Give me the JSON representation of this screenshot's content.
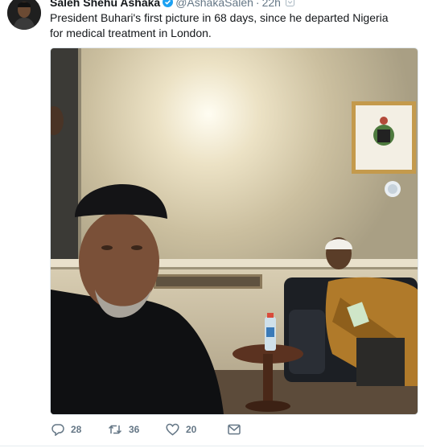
{
  "tweet": {
    "author_name": "Saleh Shehu Ashaka",
    "handle": "@AshakaSaleh",
    "separator": "·",
    "time": "22h",
    "text": "President Buhari's first picture in 68 days, since he departed Nigeria for medical treatment in London.",
    "verified": true
  },
  "actions": {
    "reply_count": "28",
    "retweet_count": "36",
    "like_count": "20"
  },
  "icons": {
    "reply": "reply-icon",
    "retweet": "retweet-icon",
    "like": "heart-icon",
    "dm": "direct-message-icon",
    "verified": "verified-badge-icon",
    "caret": "chevron-down-icon"
  },
  "colors": {
    "text_secondary": "#657786",
    "verified_blue": "#1da1f2",
    "divider": "#e6ecf0"
  }
}
